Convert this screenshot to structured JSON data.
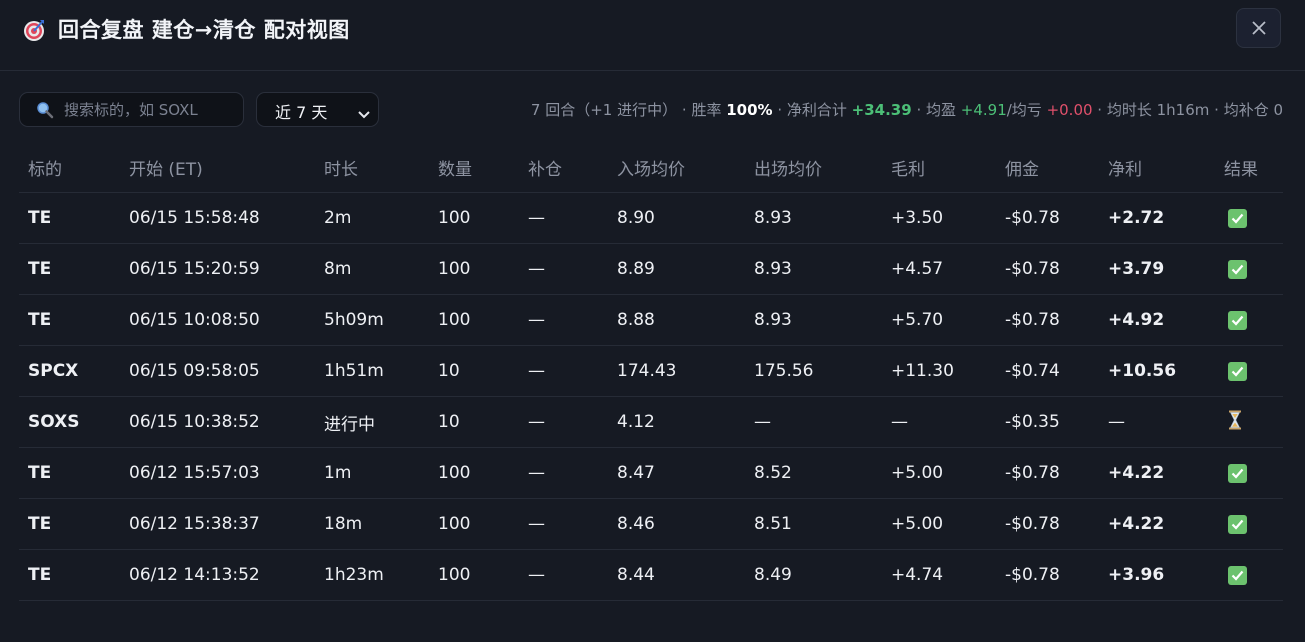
{
  "header": {
    "title": "回合复盘 建仓→清仓 配对视图",
    "title_icon": "target-icon",
    "close_icon": "close-icon"
  },
  "toolbar": {
    "search_placeholder": "搜索标的，如 SOXL",
    "search_value": "",
    "range_selected": "近 7 天"
  },
  "summary": {
    "rounds": "7 回合（+1 进行中）",
    "sep1": " · ",
    "winrate_label": "胜率 ",
    "winrate_value": "100%",
    "sep2": " · ",
    "net_label": "净利合计 ",
    "net_value": "+34.39",
    "sep3": " · ",
    "avg_win_label": "均盈 ",
    "avg_win_value": "+4.91",
    "avg_loss_label": "/均亏 ",
    "avg_loss_value": "+0.00",
    "sep4": " · ",
    "avg_dur": "均时长 1h16m",
    "sep5": " · ",
    "avg_add": "均补仓 0"
  },
  "table": {
    "columns": [
      "标的",
      "开始 (ET)",
      "时长",
      "数量",
      "补仓",
      "入场均价",
      "出场均价",
      "毛利",
      "佣金",
      "净利",
      "结果"
    ],
    "rows": [
      {
        "symbol": "TE",
        "start": "06/15 15:58:48",
        "duration": "2m",
        "qty": "100",
        "add": "—",
        "entry": "8.90",
        "exit": "8.93",
        "gross": "+3.50",
        "fee": "-$0.78",
        "net": "+2.72",
        "result": "check"
      },
      {
        "symbol": "TE",
        "start": "06/15 15:20:59",
        "duration": "8m",
        "qty": "100",
        "add": "—",
        "entry": "8.89",
        "exit": "8.93",
        "gross": "+4.57",
        "fee": "-$0.78",
        "net": "+3.79",
        "result": "check"
      },
      {
        "symbol": "TE",
        "start": "06/15 10:08:50",
        "duration": "5h09m",
        "qty": "100",
        "add": "—",
        "entry": "8.88",
        "exit": "8.93",
        "gross": "+5.70",
        "fee": "-$0.78",
        "net": "+4.92",
        "result": "check"
      },
      {
        "symbol": "SPCX",
        "start": "06/15 09:58:05",
        "duration": "1h51m",
        "qty": "10",
        "add": "—",
        "entry": "174.43",
        "exit": "175.56",
        "gross": "+11.30",
        "fee": "-$0.74",
        "net": "+10.56",
        "result": "check"
      },
      {
        "symbol": "SOXS",
        "start": "06/15 10:38:52",
        "duration": "进行中",
        "qty": "10",
        "add": "—",
        "entry": "4.12",
        "exit": "—",
        "gross": "—",
        "fee": "-$0.35",
        "net": "—",
        "result": "hourglass"
      },
      {
        "symbol": "TE",
        "start": "06/12 15:57:03",
        "duration": "1m",
        "qty": "100",
        "add": "—",
        "entry": "8.47",
        "exit": "8.52",
        "gross": "+5.00",
        "fee": "-$0.78",
        "net": "+4.22",
        "result": "check"
      },
      {
        "symbol": "TE",
        "start": "06/12 15:38:37",
        "duration": "18m",
        "qty": "100",
        "add": "—",
        "entry": "8.46",
        "exit": "8.51",
        "gross": "+5.00",
        "fee": "-$0.78",
        "net": "+4.22",
        "result": "check"
      },
      {
        "symbol": "TE",
        "start": "06/12 14:13:52",
        "duration": "1h23m",
        "qty": "100",
        "add": "—",
        "entry": "8.44",
        "exit": "8.49",
        "gross": "+4.74",
        "fee": "-$0.78",
        "net": "+3.96",
        "result": "check"
      }
    ]
  },
  "colors": {
    "background": "#161a23",
    "profit": "#4cbf77",
    "loss": "#d9536c",
    "in_progress": "#5a8cff",
    "muted": "#8d93a1"
  }
}
